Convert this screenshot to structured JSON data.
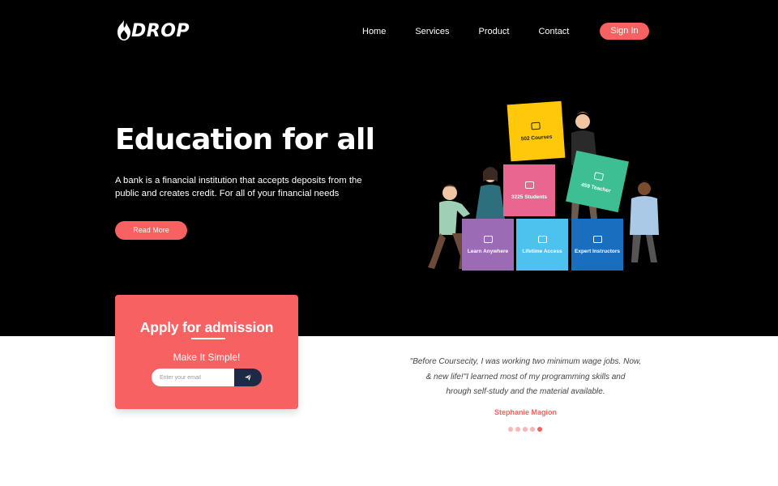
{
  "brand": {
    "name": "DROP"
  },
  "nav": {
    "items": [
      "Home",
      "Services",
      "Product",
      "Contact"
    ],
    "signin_label": "Sign In"
  },
  "hero": {
    "title": "Education for all",
    "description": "A bank is a financial institution that accepts deposits from the public and creates credit. For all of your financial needs",
    "button_label": "Read More"
  },
  "illustration": {
    "tiles": [
      {
        "label": "502 Courses",
        "color": "#ffc80a"
      },
      {
        "label": "3225 Students",
        "color": "#e8668f"
      },
      {
        "label": "459 Teacher",
        "color": "#3ebf93"
      },
      {
        "label": "Learn Anywhere",
        "color": "#9b6bb6"
      },
      {
        "label": "Lifetime Access",
        "color": "#4dc2ee"
      },
      {
        "label": "Expert Instructors",
        "color": "#1a6ebf"
      }
    ]
  },
  "apply": {
    "title": "Apply for admission",
    "subtitle": "Make It Simple!",
    "email_placeholder": "Enter your email",
    "send_icon": "paper-plane-icon"
  },
  "testimonial": {
    "lines": [
      "\"Before Coursecity, I was working two minimum wage jobs. Now,",
      "& new life!\"I learned most of my programming skills and",
      "hrough self-study and the material available."
    ],
    "author": "Stephanie Magion",
    "dots_count": 5,
    "active_dot": 5
  },
  "colors": {
    "accent": "#f86161",
    "hero_bg": "#000000",
    "send_button": "#1d2a45"
  }
}
